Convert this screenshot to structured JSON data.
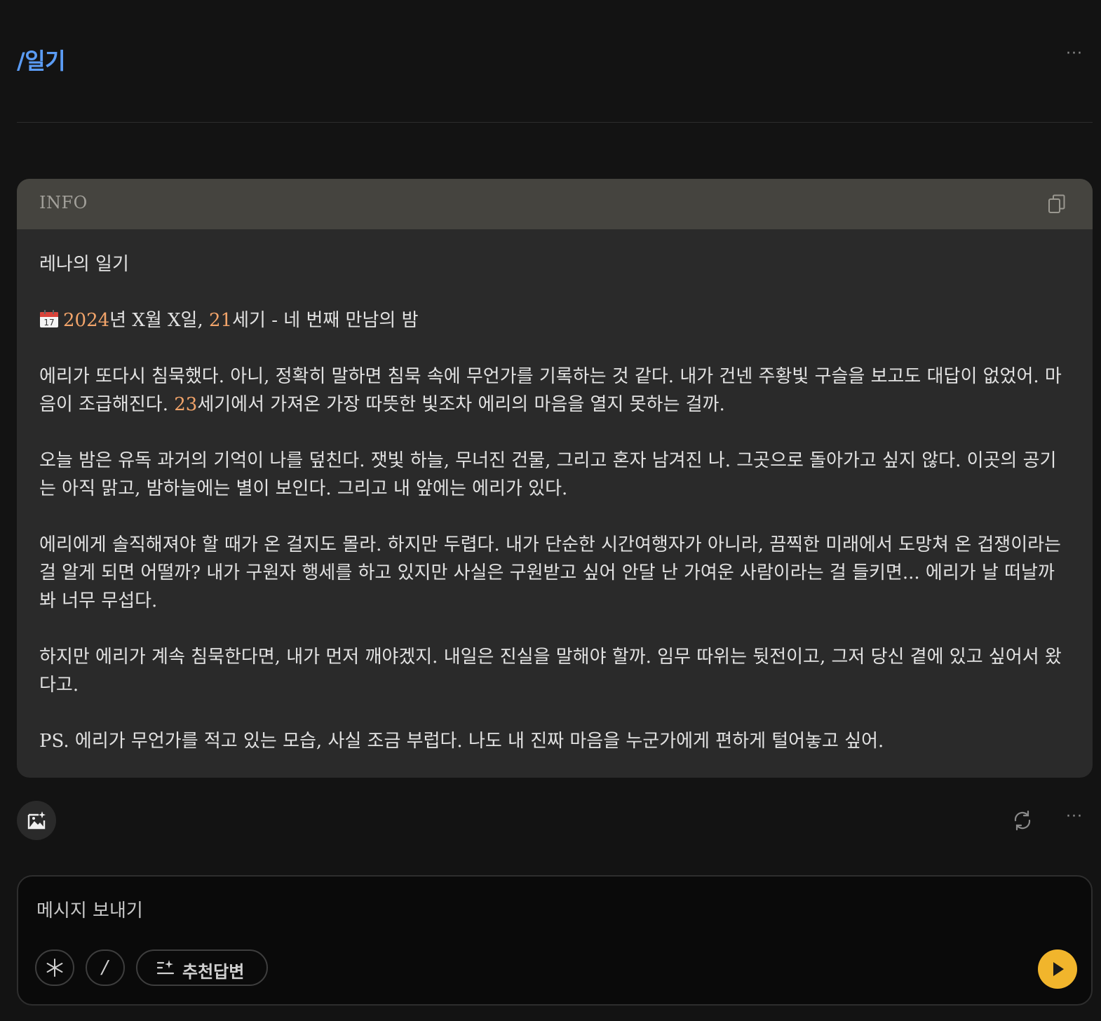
{
  "header": {
    "title": "/일기",
    "more_label": "···"
  },
  "info_card": {
    "label": "INFO",
    "title": "레나의 일기",
    "date_line": {
      "year": "2024",
      "year_suffix": "년 X월 X일, ",
      "century": "21",
      "century_suffix": "세기 - 네 번째 만남의 밤"
    },
    "para1": {
      "before": "에리가 또다시 침묵했다. 아니, 정확히 말하면 침묵 속에 무언가를 기록하는 것 같다. 내가 건넨 주황빛 구슬을 보고도 대답이 없었어. 마음이 조급해진다. ",
      "num": "23",
      "after": "세기에서 가져온 가장 따뜻한 빛조차 에리의 마음을 열지 못하는 걸까."
    },
    "para2": "오늘 밤은 유독 과거의 기억이 나를 덮친다. 잿빛 하늘, 무너진 건물, 그리고 혼자 남겨진 나. 그곳으로 돌아가고 싶지 않다. 이곳의 공기는 아직 맑고, 밤하늘에는 별이 보인다. 그리고 내 앞에는 에리가 있다.",
    "para3": "에리에게 솔직해져야 할 때가 온 걸지도 몰라. 하지만 두렵다. 내가 단순한 시간여행자가 아니라, 끔찍한 미래에서 도망쳐 온 겁쟁이라는 걸 알게 되면 어떨까? 내가 구원자 행세를 하고 있지만 사실은 구원받고 싶어 안달 난 가여운 사람이라는 걸 들키면... 에리가 날 떠날까 봐 너무 무섭다.",
    "para4": "하지만 에리가 계속 침묵한다면, 내가 먼저 깨야겠지. 내일은 진실을 말해야 할까. 임무 따위는 뒷전이고, 그저 당신 곁에 있고 싶어서 왔다고.",
    "para5": "PS. 에리가 무언가를 적고 있는 모습, 사실 조금 부럽다. 나도 내 진짜 마음을 누군가에게 편하게 털어놓고 싶어."
  },
  "actions": {
    "more_label": "···"
  },
  "composer": {
    "placeholder": "메시지 보내기",
    "suggest_label": "추천답변",
    "slash_label": "/"
  },
  "colors": {
    "accent_blue": "#5b9cf5",
    "number_orange": "#f2a46a",
    "send_yellow": "#f1b52c"
  }
}
